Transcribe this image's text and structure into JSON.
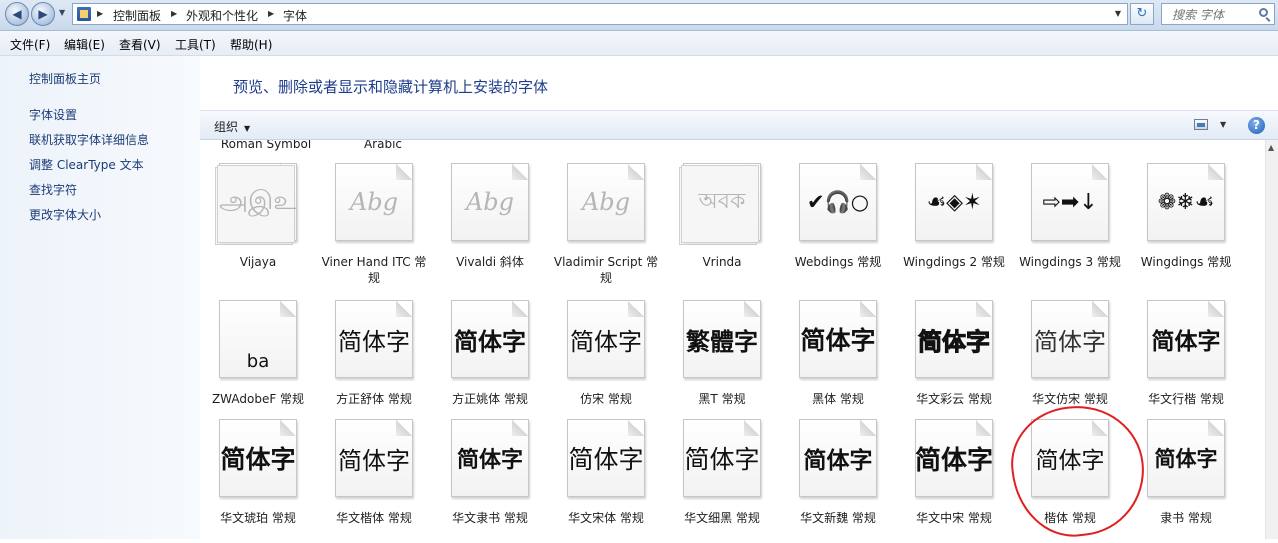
{
  "address": {
    "crumbs": [
      "控制面板",
      "外观和个性化",
      "字体"
    ]
  },
  "search": {
    "placeholder": "搜索 字体"
  },
  "menu": [
    "文件(F)",
    "编辑(E)",
    "查看(V)",
    "工具(T)",
    "帮助(H)"
  ],
  "sidebar": {
    "home": "控制面板主页",
    "links": [
      "字体设置",
      "联机获取字体详细信息",
      "调整 ClearType 文本",
      "查找字符",
      "更改字体大小"
    ]
  },
  "main": {
    "headline": "预览、删除或者显示和隐藏计算机上安装的字体",
    "organize": "组织",
    "partial_labels": [
      "Roman Symbol",
      "Arabic"
    ],
    "rows": [
      [
        {
          "label": "Vijaya",
          "sample": "அஇஉ",
          "faded": true,
          "stack": true
        },
        {
          "label": "Viner Hand ITC 常规",
          "sample": "Abg",
          "faded": true,
          "stack": false
        },
        {
          "label": "Vivaldi 斜体",
          "sample": "Abg",
          "faded": true,
          "stack": false
        },
        {
          "label": "Vladimir Script 常规",
          "sample": "Abg",
          "faded": true,
          "stack": false
        },
        {
          "label": "Vrinda",
          "sample": "অবক",
          "faded": true,
          "stack": true
        },
        {
          "label": "Webdings 常规",
          "sample": "✔🎧○",
          "faded": false,
          "stack": false
        },
        {
          "label": "Wingdings 2 常规",
          "sample": "☙◈✶",
          "faded": false,
          "stack": false
        },
        {
          "label": "Wingdings 3 常规",
          "sample": "⇨➡↓",
          "faded": false,
          "stack": false
        },
        {
          "label": "Wingdings 常规",
          "sample": "❁❄☙",
          "faded": false,
          "stack": false
        }
      ],
      [
        {
          "label": "ZWAdobeF 常规",
          "sample": "ba",
          "faded": false,
          "stack": false
        },
        {
          "label": "方正舒体 常规",
          "sample": "简体字",
          "faded": false,
          "stack": false
        },
        {
          "label": "方正姚体 常规",
          "sample": "简体字",
          "faded": false,
          "stack": false
        },
        {
          "label": "仿宋 常规",
          "sample": "简体字",
          "faded": false,
          "stack": false
        },
        {
          "label": "黑T 常规",
          "sample": "繁體字",
          "faded": false,
          "stack": false
        },
        {
          "label": "黑体 常规",
          "sample": "简体字",
          "faded": false,
          "stack": false
        },
        {
          "label": "华文彩云 常规",
          "sample": "简体字",
          "faded": false,
          "stack": false
        },
        {
          "label": "华文仿宋 常规",
          "sample": "简体字",
          "faded": false,
          "stack": false
        },
        {
          "label": "华文行楷 常规",
          "sample": "简体字",
          "faded": false,
          "stack": false
        }
      ],
      [
        {
          "label": "华文琥珀 常规",
          "sample": "简体字",
          "faded": false,
          "stack": false
        },
        {
          "label": "华文楷体 常规",
          "sample": "简体字",
          "faded": false,
          "stack": false
        },
        {
          "label": "华文隶书 常规",
          "sample": "简体字",
          "faded": false,
          "stack": false
        },
        {
          "label": "华文宋体 常规",
          "sample": "简体字",
          "faded": false,
          "stack": false
        },
        {
          "label": "华文细黑 常规",
          "sample": "简体字",
          "faded": false,
          "stack": false
        },
        {
          "label": "华文新魏 常规",
          "sample": "简体字",
          "faded": false,
          "stack": false
        },
        {
          "label": "华文中宋 常规",
          "sample": "简体字",
          "faded": false,
          "stack": false
        },
        {
          "label": "楷体 常规",
          "sample": "简体字",
          "faded": false,
          "stack": false
        },
        {
          "label": "隶书 常规",
          "sample": "简体字",
          "faded": false,
          "stack": false
        }
      ]
    ]
  },
  "colors": {
    "annotation": "#e02020",
    "link": "#1c3c78",
    "headline": "#1e3c8a"
  }
}
